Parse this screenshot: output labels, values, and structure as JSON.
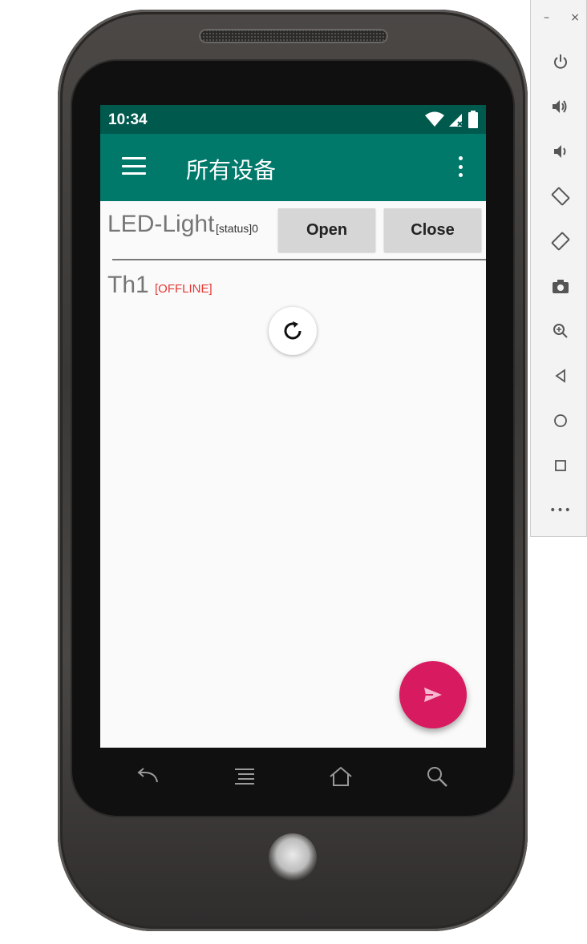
{
  "status_bar": {
    "time": "10:34"
  },
  "app_bar": {
    "title": "所有设备"
  },
  "devices": [
    {
      "name": "LED-Light",
      "status": "[status]0",
      "open_label": "Open",
      "close_label": "Close"
    },
    {
      "name": "Th1",
      "status": "[OFFLINE]"
    }
  ],
  "colors": {
    "primary": "#00796b",
    "primary_dark": "#00594d",
    "accent": "#d81b60",
    "offline": "#e53935"
  },
  "icons": {
    "menu": "hamburger-icon",
    "overflow": "more-vert-icon",
    "refresh": "refresh-icon",
    "fab": "send-icon"
  },
  "emulator_panel": {
    "minimize": "–",
    "close": "×",
    "more": "•••"
  }
}
